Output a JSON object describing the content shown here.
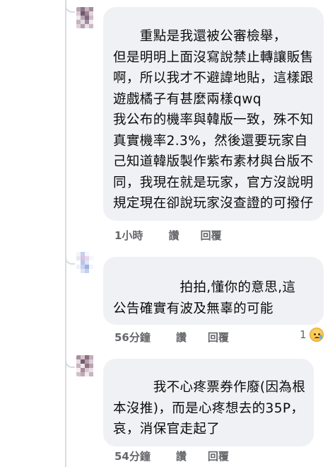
{
  "comments": [
    {
      "lines": [
        "　　重點是我還被公審檢舉，",
        "但是明明上面沒寫說禁止轉讓販售",
        "啊，所以我才不避諱地貼，這樣跟",
        "遊戲橘子有甚麼兩樣qwq",
        "我公布的機率與韓版一致，殊不知",
        "真實機率2.3%，然後還要玩家自",
        "己知道韓版製作紫布素材與台版不",
        "同，我現在就是玩家，官方沒說明",
        "規定現在卻說玩家沒查證的可撥仔"
      ],
      "time": "1小時",
      "like": "讚",
      "reply": "回覆"
    },
    {
      "lines": [
        "　　　　　拍拍,懂你的意思,這",
        "公告確實有波及無辜的可能"
      ],
      "time": "56分鐘",
      "like": "讚",
      "reply": "回覆",
      "reaction": {
        "count": "1",
        "emoji": "sad-tear-emoji"
      }
    },
    {
      "lines": [
        "　　　我不心疼票券作廢(因為根",
        "本沒推)，而是心疼想去的35P，",
        "哀，消保官走起了"
      ],
      "time": "54分鐘",
      "like": "讚",
      "reply": "回覆"
    }
  ]
}
